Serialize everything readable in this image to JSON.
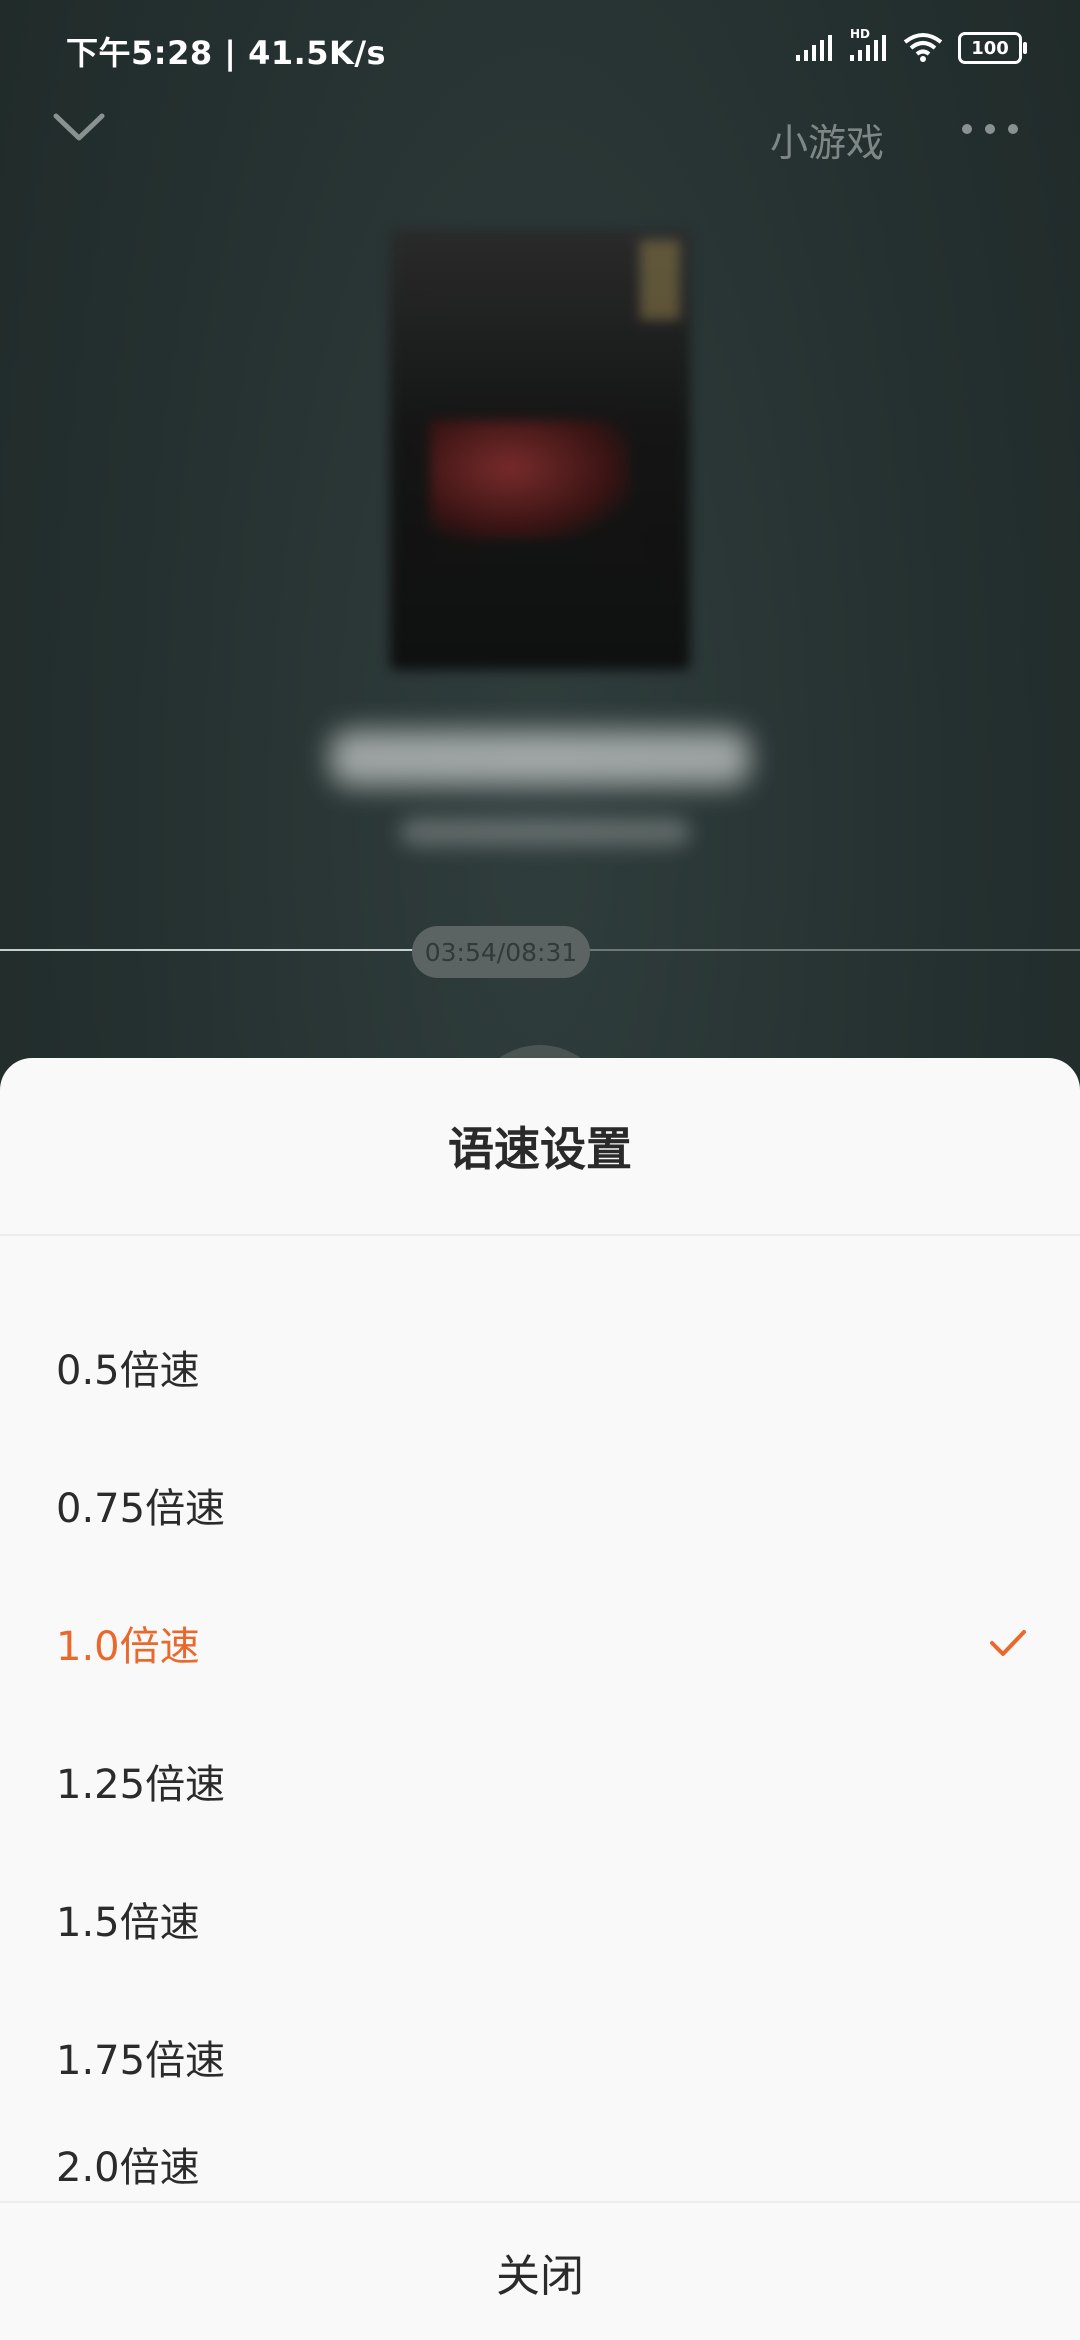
{
  "status_bar": {
    "time": "下午5:28",
    "separator": "|",
    "net_speed": "41.5K/s",
    "battery": "100",
    "hd": "HD"
  },
  "header": {
    "games_label": "小游戏"
  },
  "player": {
    "time_display": "03:54/08:31",
    "progress_fraction": 0.459
  },
  "speed_sheet": {
    "title": "语速设置",
    "options": [
      {
        "label": "0.5倍速",
        "selected": false
      },
      {
        "label": "0.75倍速",
        "selected": false
      },
      {
        "label": "1.0倍速",
        "selected": true
      },
      {
        "label": "1.25倍速",
        "selected": false
      },
      {
        "label": "1.5倍速",
        "selected": false
      },
      {
        "label": "1.75倍速",
        "selected": false
      },
      {
        "label": "2.0倍速",
        "selected": false
      }
    ],
    "close_label": "关闭"
  },
  "colors": {
    "accent": "#e8692b",
    "sheet_bg": "#f9f9f9",
    "text": "#2b2b2b"
  }
}
